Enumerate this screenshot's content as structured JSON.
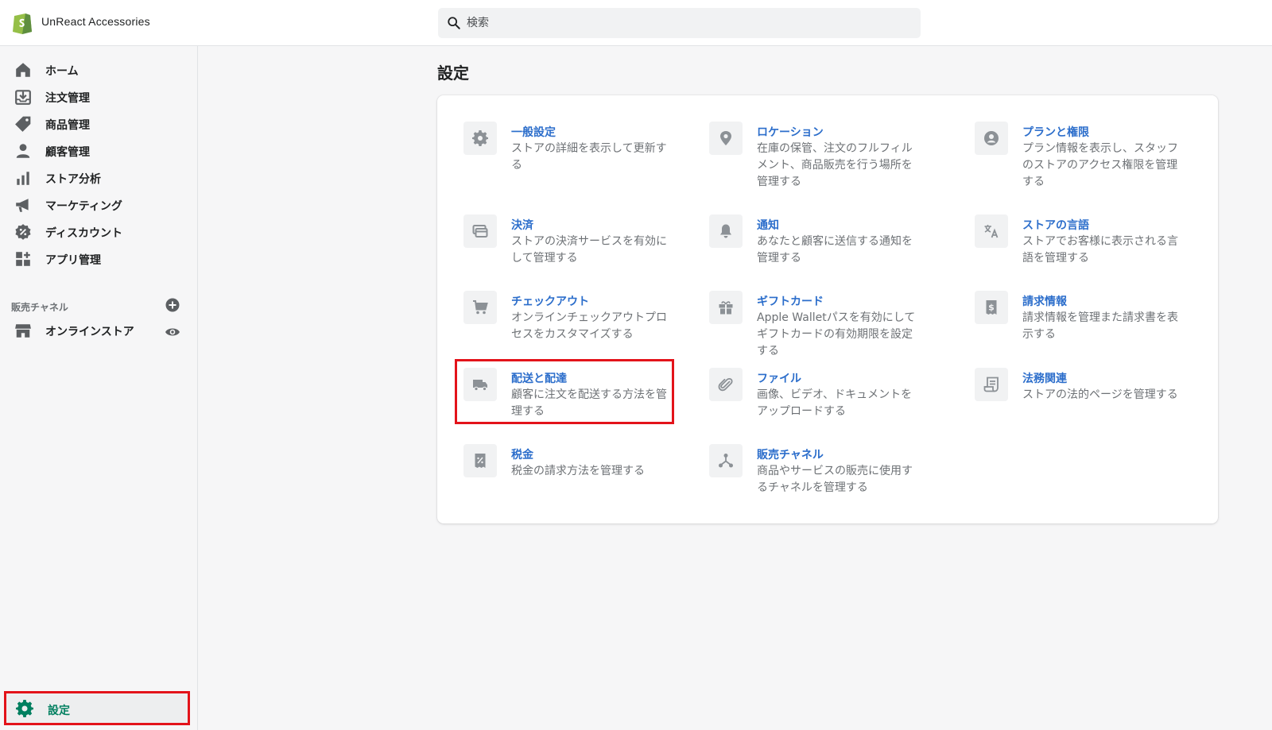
{
  "app": {
    "store_name": "UnReact Accessories"
  },
  "search": {
    "placeholder": "検索"
  },
  "sidebar": {
    "items": [
      {
        "label": "ホーム",
        "icon": "home-icon"
      },
      {
        "label": "注文管理",
        "icon": "orders-icon"
      },
      {
        "label": "商品管理",
        "icon": "tag-icon"
      },
      {
        "label": "顧客管理",
        "icon": "customer-icon"
      },
      {
        "label": "ストア分析",
        "icon": "analytics-icon"
      },
      {
        "label": "マーケティング",
        "icon": "megaphone-icon"
      },
      {
        "label": "ディスカウント",
        "icon": "discount-icon"
      },
      {
        "label": "アプリ管理",
        "icon": "apps-icon"
      }
    ],
    "sales_channels_title": "販売チャネル",
    "channels": [
      {
        "label": "オンラインストア",
        "icon": "store-icon"
      }
    ],
    "settings_label": "設定"
  },
  "main": {
    "title": "設定",
    "tiles": [
      {
        "title": "一般設定",
        "desc": "ストアの詳細を表示して更新する",
        "icon": "gear-icon"
      },
      {
        "title": "ロケーション",
        "desc": "在庫の保管、注文のフルフィルメント、商品販売を行う場所を管理する",
        "icon": "location-pin-icon"
      },
      {
        "title": "プランと権限",
        "desc": "プラン情報を表示し、スタッフのストアのアクセス権限を管理する",
        "icon": "user-circle-icon"
      },
      {
        "title": "決済",
        "desc": "ストアの決済サービスを有効にして管理する",
        "icon": "payment-icon"
      },
      {
        "title": "通知",
        "desc": "あなたと顧客に送信する通知を管理する",
        "icon": "bell-icon"
      },
      {
        "title": "ストアの言語",
        "desc": "ストアでお客様に表示される言語を管理する",
        "icon": "translate-icon"
      },
      {
        "title": "チェックアウト",
        "desc": "オンラインチェックアウトプロセスをカスタマイズする",
        "icon": "cart-icon"
      },
      {
        "title": "ギフトカード",
        "desc": "Apple Walletパスを有効にしてギフトカードの有効期限を設定する",
        "icon": "gift-icon"
      },
      {
        "title": "請求情報",
        "desc": "請求情報を管理また請求書を表示する",
        "icon": "billing-icon"
      },
      {
        "title": "配送と配達",
        "desc": "顧客に注文を配送する方法を管理する",
        "icon": "truck-icon"
      },
      {
        "title": "ファイル",
        "desc": "画像、ビデオ、ドキュメントをアップロードする",
        "icon": "paperclip-icon"
      },
      {
        "title": "法務関連",
        "desc": "ストアの法的ページを管理する",
        "icon": "legal-icon"
      },
      {
        "title": "税金",
        "desc": "税金の請求方法を管理する",
        "icon": "tax-icon"
      },
      {
        "title": "販売チャネル",
        "desc": "商品やサービスの販売に使用するチャネルを管理する",
        "icon": "channels-icon"
      }
    ]
  },
  "colors": {
    "link": "#2c6ecb",
    "settings_active": "#007f5f",
    "highlight": "#e3131a",
    "brand": "#95bf47"
  }
}
